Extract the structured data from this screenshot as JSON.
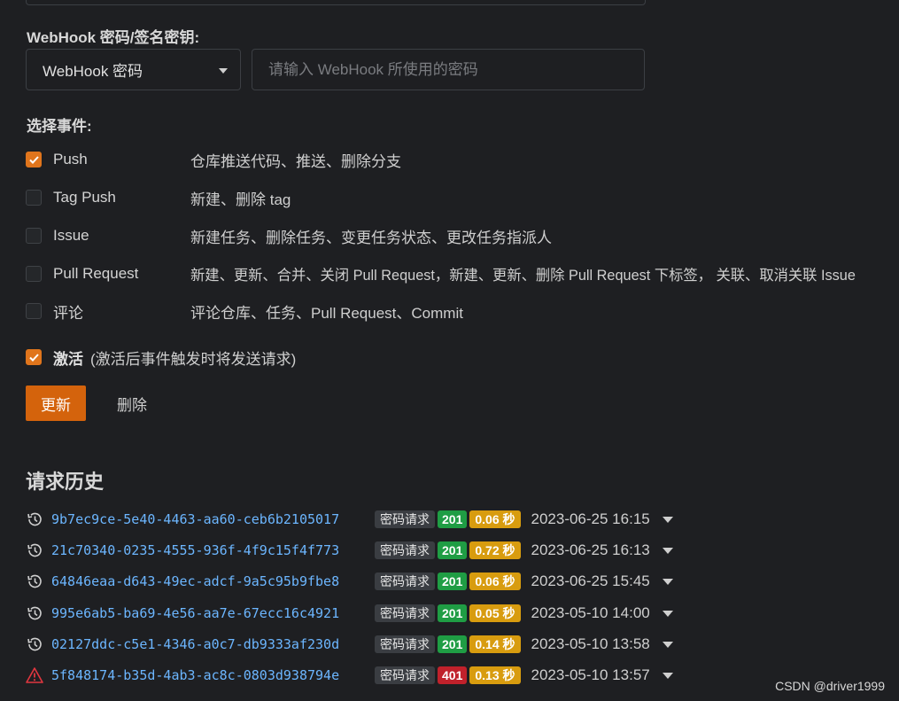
{
  "secret_section": {
    "label": "WebHook 密码/签名密钥:",
    "select_value": "WebHook 密码",
    "input_placeholder": "请输入 WebHook 所使用的密码"
  },
  "events_section": {
    "label": "选择事件:",
    "events": [
      {
        "name": "Push",
        "description": "仓库推送代码、推送、删除分支",
        "checked": true
      },
      {
        "name": "Tag Push",
        "description": "新建、删除 tag",
        "checked": false
      },
      {
        "name": "Issue",
        "description": "新建任务、删除任务、变更任务状态、更改任务指派人",
        "checked": false
      },
      {
        "name": "Pull Request",
        "description": "新建、更新、合并、关闭 Pull Request，新建、更新、删除 Pull Request 下标签， 关联、取消关联 Issue",
        "checked": false
      },
      {
        "name": "评论",
        "description": "评论仓库、任务、Pull Request、Commit",
        "checked": false
      }
    ]
  },
  "activate": {
    "label": "激活",
    "note": "(激活后事件触发时将发送请求)",
    "checked": true
  },
  "actions": {
    "update_label": "更新",
    "delete_label": "删除"
  },
  "history": {
    "title": "请求历史",
    "items": [
      {
        "id": "9b7ec9ce-5e40-4463-aa60-ceb6b2105017",
        "type": "密码请求",
        "status": "201",
        "duration": "0.06 秒",
        "date": "2023-06-25 16:15",
        "icon": "history-icon"
      },
      {
        "id": "21c70340-0235-4555-936f-4f9c15f4f773",
        "type": "密码请求",
        "status": "201",
        "duration": "0.72 秒",
        "date": "2023-06-25 16:13",
        "icon": "history-icon"
      },
      {
        "id": "64846eaa-d643-49ec-adcf-9a5c95b9fbe8",
        "type": "密码请求",
        "status": "201",
        "duration": "0.06 秒",
        "date": "2023-06-25 15:45",
        "icon": "history-icon"
      },
      {
        "id": "995e6ab5-ba69-4e56-aa7e-67ecc16c4921",
        "type": "密码请求",
        "status": "201",
        "duration": "0.05 秒",
        "date": "2023-05-10 14:00",
        "icon": "history-icon"
      },
      {
        "id": "02127ddc-c5e1-4346-a0c7-db9333af230d",
        "type": "密码请求",
        "status": "201",
        "duration": "0.14 秒",
        "date": "2023-05-10 13:58",
        "icon": "history-icon"
      },
      {
        "id": "5f848174-b35d-4ab3-ac8c-0803d938794e",
        "type": "密码请求",
        "status": "401",
        "duration": "0.13 秒",
        "date": "2023-05-10 13:57",
        "icon": "warning-icon"
      }
    ]
  },
  "colors": {
    "accent": "#e0751c",
    "success": "#1f9d44",
    "error": "#c0212b",
    "duration": "#d89c0f",
    "link": "#6cb6ff"
  },
  "watermark": "CSDN @driver1999"
}
